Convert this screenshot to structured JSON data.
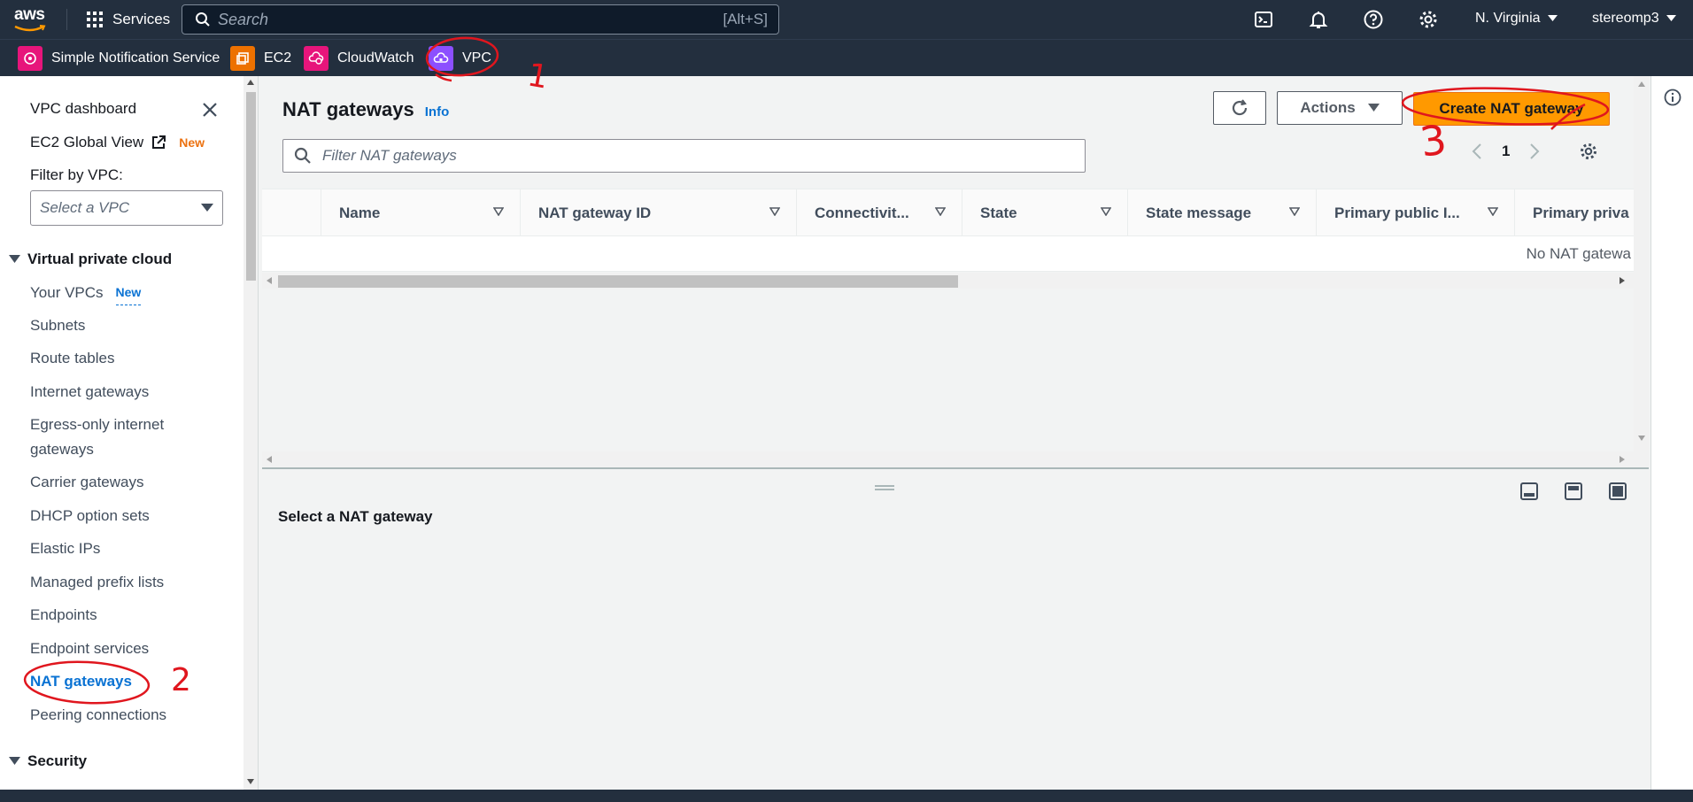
{
  "topnav": {
    "logo_text": "aws",
    "services_label": "Services",
    "search_placeholder": "Search",
    "search_shortcut": "[Alt+S]",
    "region": "N. Virginia",
    "account": "stereomp3",
    "icons": [
      "cloudshell-icon",
      "bell-icon",
      "help-icon",
      "gear-icon"
    ]
  },
  "favorites": [
    {
      "label": "Simple Notification Service",
      "color": "#e7157b"
    },
    {
      "label": "EC2",
      "color": "#ed7100"
    },
    {
      "label": "CloudWatch",
      "color": "#e7157b"
    },
    {
      "label": "VPC",
      "color": "#8c4fff"
    }
  ],
  "sidebar": {
    "dashboard": "VPC dashboard",
    "global_view": "EC2 Global View",
    "global_view_badge": "New",
    "filter_label": "Filter by VPC:",
    "filter_placeholder": "Select a VPC",
    "section_vpc": "Virtual private cloud",
    "items": [
      {
        "label": "Your VPCs",
        "badge": "New"
      },
      {
        "label": "Subnets"
      },
      {
        "label": "Route tables"
      },
      {
        "label": "Internet gateways"
      },
      {
        "label": "Egress-only internet gateways"
      },
      {
        "label": "Carrier gateways"
      },
      {
        "label": "DHCP option sets"
      },
      {
        "label": "Elastic IPs"
      },
      {
        "label": "Managed prefix lists"
      },
      {
        "label": "Endpoints"
      },
      {
        "label": "Endpoint services"
      },
      {
        "label": "NAT gateways",
        "active": true
      },
      {
        "label": "Peering connections"
      }
    ],
    "section_security": "Security"
  },
  "main": {
    "title": "NAT gateways",
    "info": "Info",
    "actions_label": "Actions",
    "create_label": "Create NAT gateway",
    "filter_placeholder": "Filter NAT gateways",
    "page": "1",
    "columns": [
      "Name",
      "NAT gateway ID",
      "Connectivit...",
      "State",
      "State message",
      "Primary public I...",
      "Primary priva"
    ],
    "empty_text": "No NAT gatewa",
    "detail_title": "Select a NAT gateway"
  },
  "annotations": [
    "1",
    "2",
    "3"
  ],
  "colors": {
    "accent": "#ff9900",
    "link": "#0972d3",
    "nav": "#232f3e",
    "annotation": "#e0161e"
  }
}
